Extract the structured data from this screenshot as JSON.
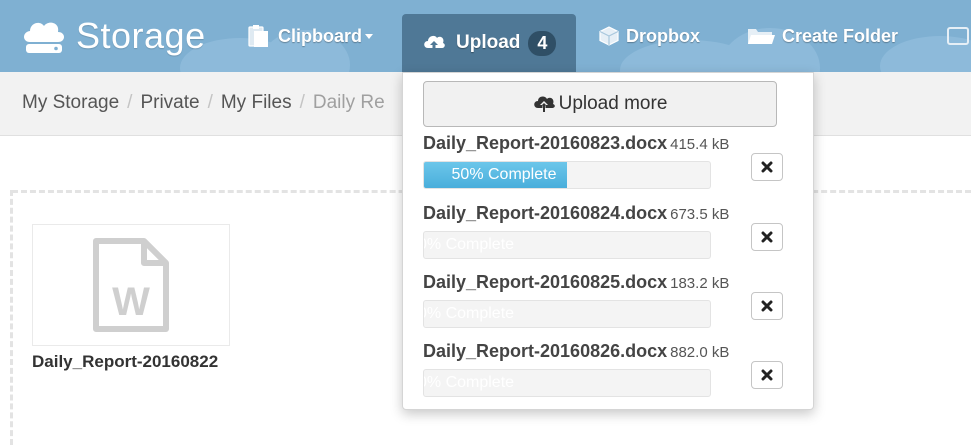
{
  "header": {
    "brand": "Storage",
    "nav": {
      "clipboard": "Clipboard",
      "upload": "Upload",
      "upload_count": "4",
      "dropbox": "Dropbox",
      "create_folder": "Create Folder"
    }
  },
  "breadcrumb": [
    "My Storage",
    "Private",
    "My Files",
    "Daily Re"
  ],
  "files": [
    {
      "name": "Daily_Report-20160822",
      "icon": "word-document-icon"
    }
  ],
  "upload_panel": {
    "upload_more_label": "Upload more",
    "items": [
      {
        "name": "Daily_Report-20160823.docx",
        "size": "415.4 kB",
        "progress": 50,
        "progress_label": "50% Complete"
      },
      {
        "name": "Daily_Report-20160824.docx",
        "size": "673.5 kB",
        "progress": 0,
        "progress_label": "0% Complete"
      },
      {
        "name": "Daily_Report-20160825.docx",
        "size": "183.2 kB",
        "progress": 0,
        "progress_label": "0% Complete"
      },
      {
        "name": "Daily_Report-20160826.docx",
        "size": "882.0 kB",
        "progress": 0,
        "progress_label": "0% Complete"
      }
    ]
  },
  "colors": {
    "header_bg": "#7fb0d2",
    "upload_active_bg": "#4f7896",
    "progress_fill": "#49aedb"
  }
}
